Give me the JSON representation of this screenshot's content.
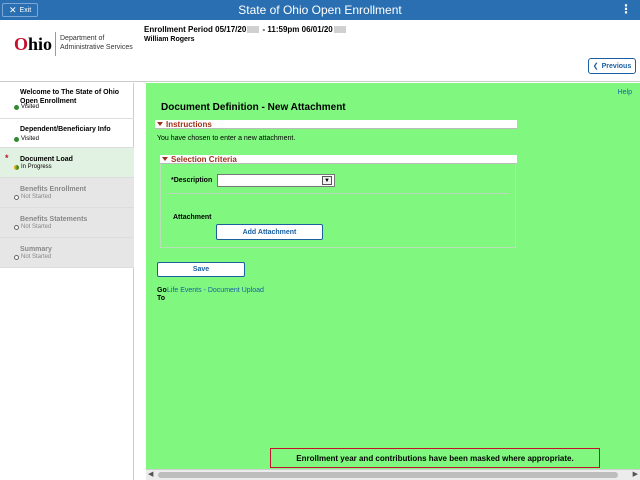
{
  "topbar": {
    "exit_label": "Exit",
    "title": "State of Ohio Open Enrollment",
    "menu_glyph": "⋮"
  },
  "header": {
    "logo_word": "hio",
    "logo_o": "O",
    "dept_line1": "Department of",
    "dept_line2": "Administrative Services",
    "enroll_prefix": "Enrollment Period 05/17/20",
    "enroll_mid": " - 11:59pm 06/01/20",
    "user_name": "William Rogers",
    "previous_label": "Previous"
  },
  "sidebar": {
    "steps": [
      {
        "title": "Welcome to The State of Ohio Open Enrollment",
        "status": "Visited"
      },
      {
        "title": "Dependent/Beneficiary Info",
        "status": "Visited"
      },
      {
        "title": "Document Load",
        "status": "In Progress"
      },
      {
        "title": "Benefits Enrollment",
        "status": "Not Started"
      },
      {
        "title": "Benefits Statements",
        "status": "Not Started"
      },
      {
        "title": "Summary",
        "status": "Not Started"
      }
    ]
  },
  "main": {
    "help_label": "Help",
    "page_title": "Document Definition - New Attachment",
    "instructions_label": "Instructions",
    "instructions_text": "You have chosen to enter a new attachment.",
    "criteria_label": "Selection Criteria",
    "description_label": "*Description",
    "description_value": "",
    "attachment_label": "Attachment",
    "add_attachment_label": "Add Attachment",
    "save_label": "Save",
    "goto_label_1": "Go",
    "goto_label_2": "To",
    "goto_link": "Life Events - Document Upload",
    "mask_notice": "Enrollment year and contributions have been masked where appropriate."
  }
}
